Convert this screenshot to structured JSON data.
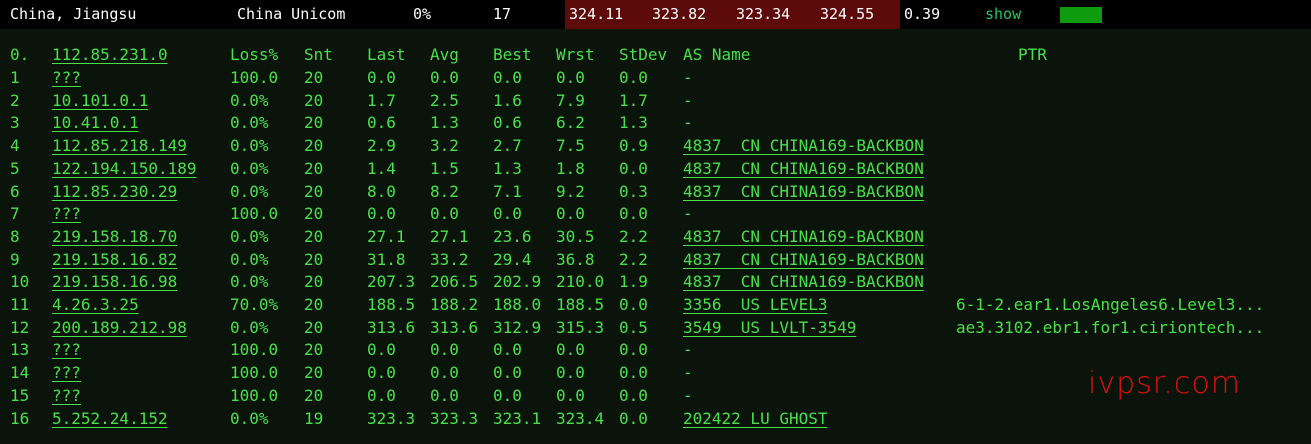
{
  "summary": {
    "location": "China, Jiangsu",
    "isp": "China Unicom",
    "loss": "0%",
    "sent": "17",
    "last": "324.11",
    "avg": "323.82",
    "best": "323.34",
    "worst": "324.55",
    "stdev": "0.39",
    "show_label": "show"
  },
  "headers": {
    "hop": "0.",
    "host": "112.85.231.0",
    "loss": "Loss%",
    "snt": "Snt",
    "last": "Last",
    "avg": "Avg",
    "best": "Best",
    "wrst": "Wrst",
    "stdev": "StDev",
    "as": "AS Name",
    "ptr": "PTR"
  },
  "hops": [
    {
      "n": "1",
      "host": "???",
      "loss": "100.0",
      "snt": "20",
      "last": "0.0",
      "avg": "0.0",
      "best": "0.0",
      "wrst": "0.0",
      "stdev": "0.0",
      "as": "-",
      "as_link": false,
      "ptr": ""
    },
    {
      "n": "2",
      "host": "10.101.0.1",
      "loss": "0.0%",
      "snt": "20",
      "last": "1.7",
      "avg": "2.5",
      "best": "1.6",
      "wrst": "7.9",
      "stdev": "1.7",
      "as": "-",
      "as_link": false,
      "ptr": ""
    },
    {
      "n": "3",
      "host": "10.41.0.1",
      "loss": "0.0%",
      "snt": "20",
      "last": "0.6",
      "avg": "1.3",
      "best": "0.6",
      "wrst": "6.2",
      "stdev": "1.3",
      "as": "-",
      "as_link": false,
      "ptr": ""
    },
    {
      "n": "4",
      "host": "112.85.218.149",
      "loss": "0.0%",
      "snt": "20",
      "last": "2.9",
      "avg": "3.2",
      "best": "2.7",
      "wrst": "7.5",
      "stdev": "0.9",
      "as": "4837  CN CHINA169-BACKBON",
      "as_link": true,
      "ptr": ""
    },
    {
      "n": "5",
      "host": "122.194.150.189",
      "loss": "0.0%",
      "snt": "20",
      "last": "1.4",
      "avg": "1.5",
      "best": "1.3",
      "wrst": "1.8",
      "stdev": "0.0",
      "as": "4837  CN CHINA169-BACKBON",
      "as_link": true,
      "ptr": ""
    },
    {
      "n": "6",
      "host": "112.85.230.29",
      "loss": "0.0%",
      "snt": "20",
      "last": "8.0",
      "avg": "8.2",
      "best": "7.1",
      "wrst": "9.2",
      "stdev": "0.3",
      "as": "4837  CN CHINA169-BACKBON",
      "as_link": true,
      "ptr": ""
    },
    {
      "n": "7",
      "host": "???",
      "loss": "100.0",
      "snt": "20",
      "last": "0.0",
      "avg": "0.0",
      "best": "0.0",
      "wrst": "0.0",
      "stdev": "0.0",
      "as": "-",
      "as_link": false,
      "ptr": ""
    },
    {
      "n": "8",
      "host": "219.158.18.70",
      "loss": "0.0%",
      "snt": "20",
      "last": "27.1",
      "avg": "27.1",
      "best": "23.6",
      "wrst": "30.5",
      "stdev": "2.2",
      "as": "4837  CN CHINA169-BACKBON",
      "as_link": true,
      "ptr": ""
    },
    {
      "n": "9",
      "host": "219.158.16.82",
      "loss": "0.0%",
      "snt": "20",
      "last": "31.8",
      "avg": "33.2",
      "best": "29.4",
      "wrst": "36.8",
      "stdev": "2.2",
      "as": "4837  CN CHINA169-BACKBON",
      "as_link": true,
      "ptr": ""
    },
    {
      "n": "10",
      "host": "219.158.16.98",
      "loss": "0.0%",
      "snt": "20",
      "last": "207.3",
      "avg": "206.5",
      "best": "202.9",
      "wrst": "210.0",
      "stdev": "1.9",
      "as": "4837  CN CHINA169-BACKBON",
      "as_link": true,
      "ptr": ""
    },
    {
      "n": "11",
      "host": "4.26.3.25",
      "loss": "70.0%",
      "snt": "20",
      "last": "188.5",
      "avg": "188.2",
      "best": "188.0",
      "wrst": "188.5",
      "stdev": "0.0",
      "as": "3356  US LEVEL3",
      "as_link": true,
      "ptr": "6-1-2.ear1.LosAngeles6.Level3..."
    },
    {
      "n": "12",
      "host": "200.189.212.98",
      "loss": "0.0%",
      "snt": "20",
      "last": "313.6",
      "avg": "313.6",
      "best": "312.9",
      "wrst": "315.3",
      "stdev": "0.5",
      "as": "3549  US LVLT-3549",
      "as_link": true,
      "ptr": "ae3.3102.ebr1.for1.ciriontech..."
    },
    {
      "n": "13",
      "host": "???",
      "loss": "100.0",
      "snt": "20",
      "last": "0.0",
      "avg": "0.0",
      "best": "0.0",
      "wrst": "0.0",
      "stdev": "0.0",
      "as": "-",
      "as_link": false,
      "ptr": ""
    },
    {
      "n": "14",
      "host": "???",
      "loss": "100.0",
      "snt": "20",
      "last": "0.0",
      "avg": "0.0",
      "best": "0.0",
      "wrst": "0.0",
      "stdev": "0.0",
      "as": "-",
      "as_link": false,
      "ptr": ""
    },
    {
      "n": "15",
      "host": "???",
      "loss": "100.0",
      "snt": "20",
      "last": "0.0",
      "avg": "0.0",
      "best": "0.0",
      "wrst": "0.0",
      "stdev": "0.0",
      "as": "-",
      "as_link": false,
      "ptr": ""
    },
    {
      "n": "16",
      "host": "5.252.24.152",
      "loss": "0.0%",
      "snt": "19",
      "last": "323.3",
      "avg": "323.3",
      "best": "323.1",
      "wrst": "323.4",
      "stdev": "0.0",
      "as": "202422 LU GHOST",
      "as_link": true,
      "ptr": ""
    }
  ],
  "watermark": "ivpsr.com",
  "colors": {
    "text": "#4be04b",
    "panel_bg": "#0b140b",
    "highlight_bg": "#5c0a0a",
    "bar": "#0e9b0e",
    "watermark": "#e01010"
  }
}
